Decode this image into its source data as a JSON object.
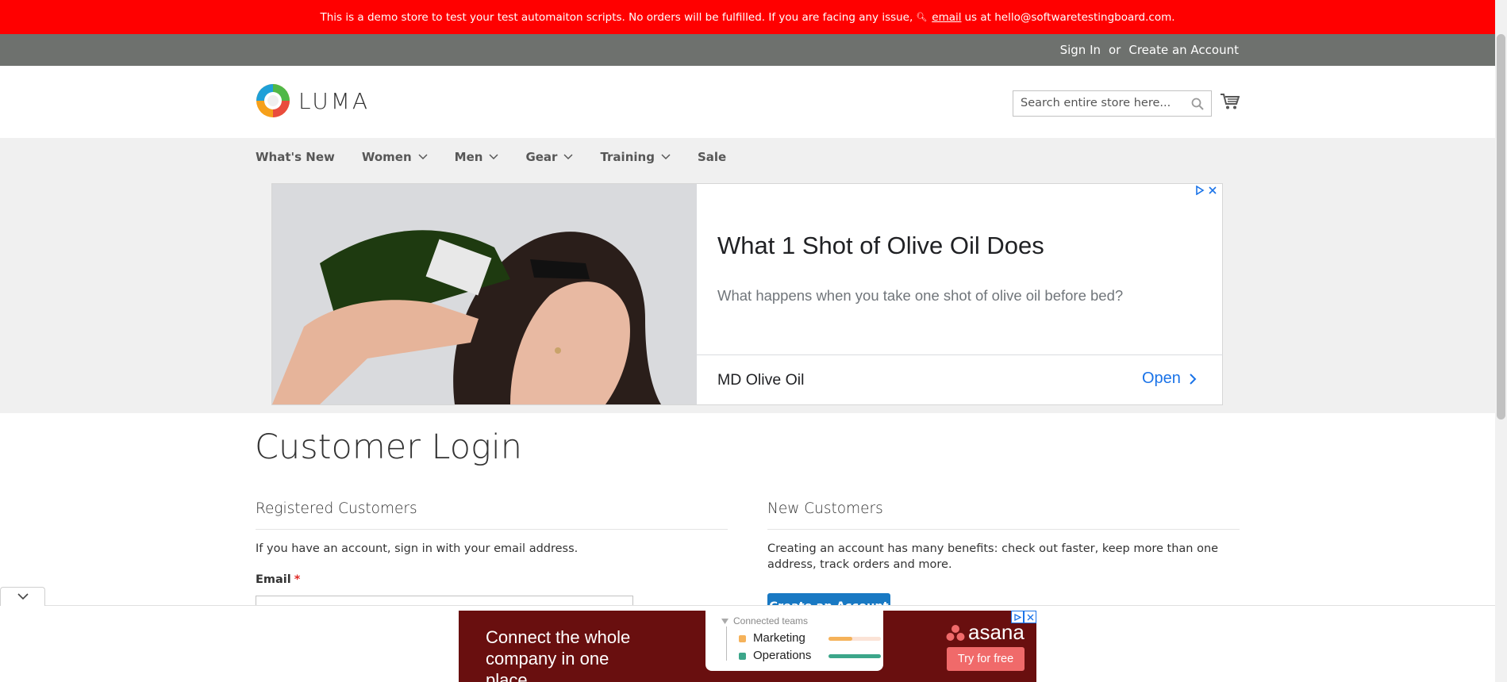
{
  "demo_notice": {
    "text_before": "This is a demo store to test your test automaiton scripts. No orders will be fulfilled. If you are facing any issue,",
    "link": "email",
    "text_after": "us at hello@softwaretestingboard.com."
  },
  "panel": {
    "sign_in": "Sign In",
    "or": "or",
    "create_account": "Create an Account"
  },
  "header": {
    "logo_text": "LUMA",
    "search_placeholder": "Search entire store here..."
  },
  "nav": {
    "items": [
      {
        "label": "What's New",
        "has_menu": false
      },
      {
        "label": "Women",
        "has_menu": true
      },
      {
        "label": "Men",
        "has_menu": true
      },
      {
        "label": "Gear",
        "has_menu": true
      },
      {
        "label": "Training",
        "has_menu": true
      },
      {
        "label": "Sale",
        "has_menu": false
      }
    ]
  },
  "ad": {
    "title": "What 1 Shot of Olive Oil Does",
    "description": "What happens when you take one shot of olive oil before bed?",
    "advertiser": "MD Olive Oil",
    "cta": "Open"
  },
  "page_title": "Customer Login",
  "registered": {
    "title": "Registered Customers",
    "intro": "If you have an account, sign in with your email address.",
    "email_label": "Email",
    "required_mark": "*"
  },
  "new_customers": {
    "title": "New Customers",
    "text": "Creating an account has many benefits: check out faster, keep more than one address, track orders and more.",
    "button": "Create an Account"
  },
  "bottom_banner": {
    "headline": "Connect the whole company in one place",
    "card_header": "Connected teams",
    "teams": [
      {
        "name": "Marketing",
        "color": "#f5b25a",
        "progress": 0.45
      },
      {
        "name": "Operations",
        "color": "#3ca68a",
        "progress": 1.0
      }
    ],
    "brand": "asana",
    "cta": "Try for free"
  },
  "colors": {
    "demo_bar": "#ff0000",
    "panel_bar": "#6e716e",
    "primary_button": "#1979c3",
    "ad_link": "#1a73e8",
    "banner_bg": "#690f0f",
    "asana_coral": "#f06a6a"
  }
}
